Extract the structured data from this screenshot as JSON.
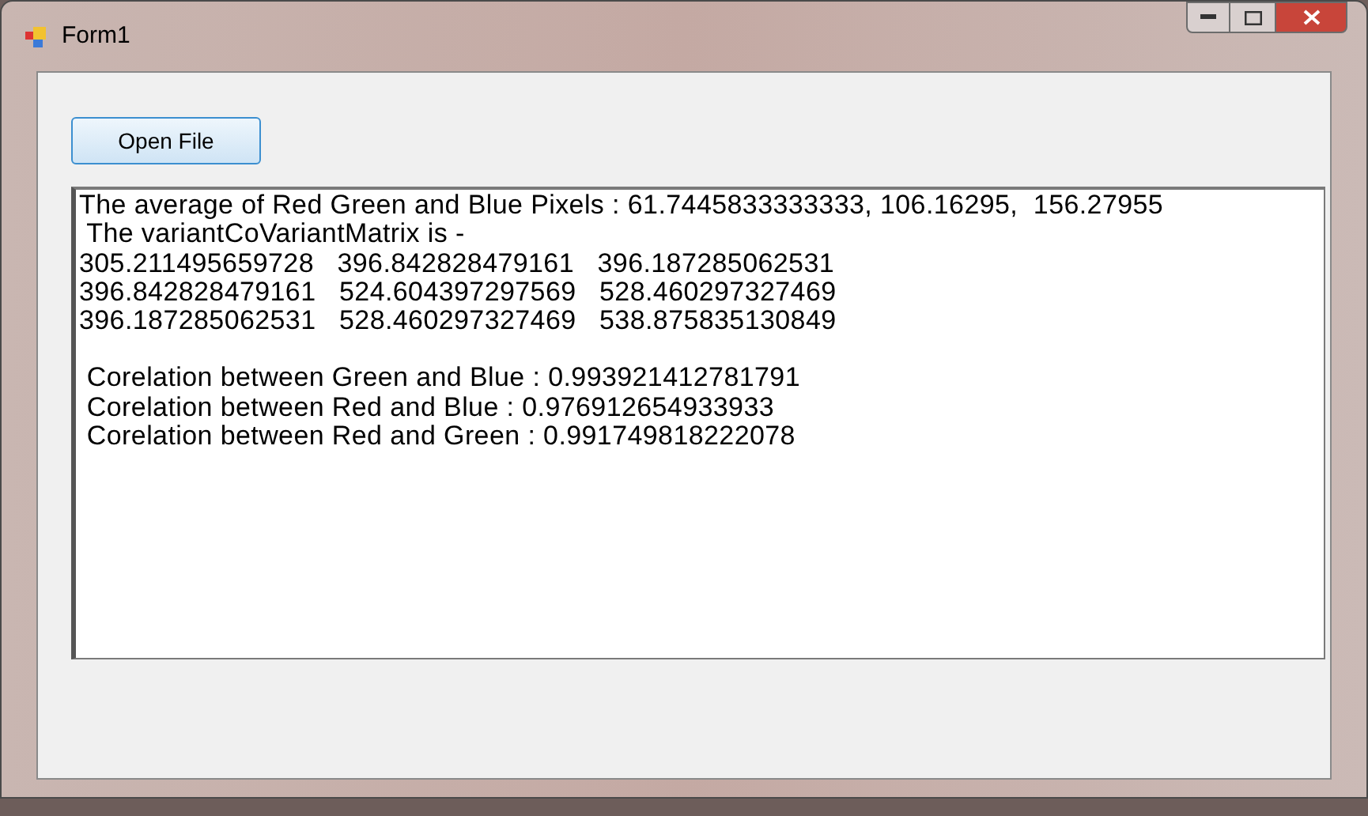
{
  "window": {
    "title": "Form1"
  },
  "button": {
    "label": "Open File"
  },
  "output": {
    "blocks": [
      {
        "lines": [
          "The average of Red Green and Blue Pixels : 61.7445833333333, 106.16295,  156.27955",
          " The variantCoVariantMatrix is -",
          "305.211495659728   396.842828479161   396.187285062531",
          "396.842828479161   524.604397297569   528.460297327469",
          "396.187285062531   528.460297327469   538.875835130849"
        ]
      },
      {
        "lines": [
          " Corelation between Green and Blue : 0.993921412781791",
          " Corelation between Red and Blue : 0.976912654933933",
          " Corelation between Red and Green : 0.991749818222078"
        ]
      }
    ]
  }
}
